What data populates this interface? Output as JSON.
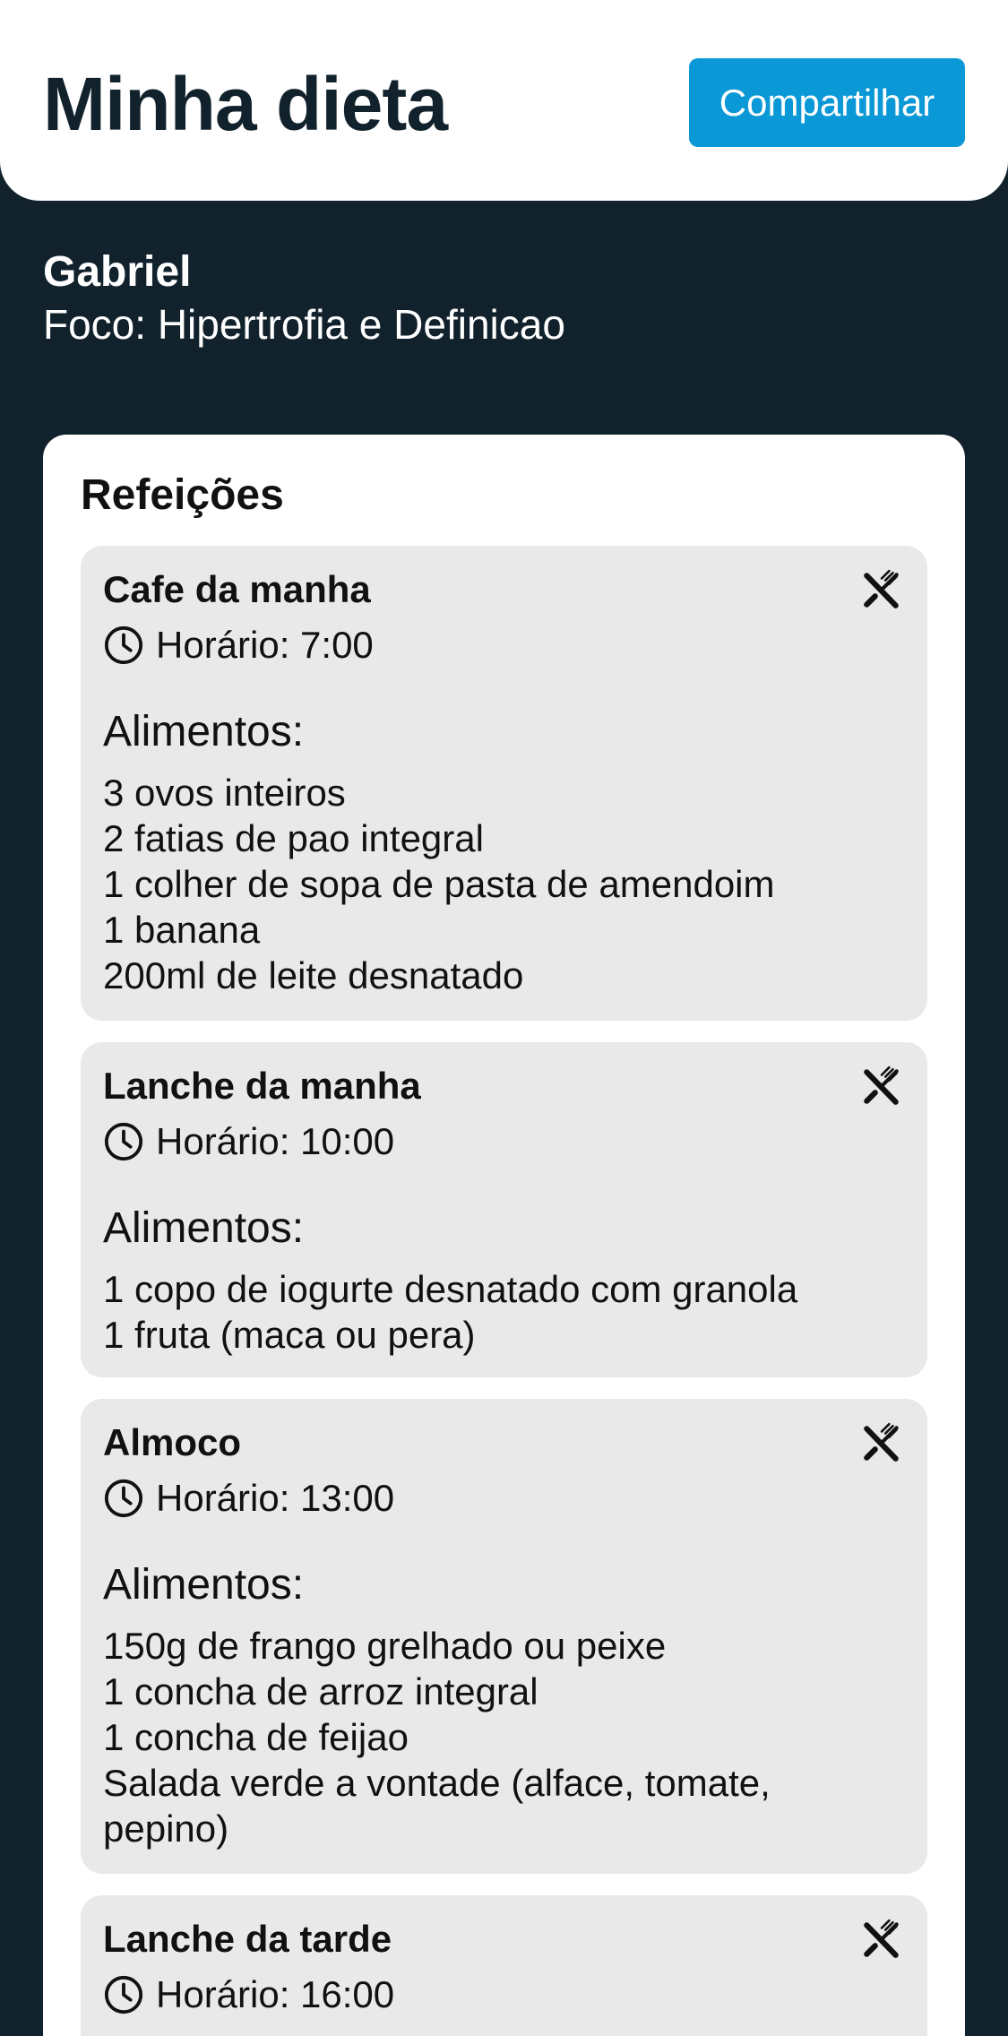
{
  "header": {
    "title": "Minha dieta",
    "share_label": "Compartilhar"
  },
  "user": {
    "name": "Gabriel",
    "focus": "Foco: Hipertrofia e Definicao"
  },
  "meals_section": {
    "title": "Refeições",
    "foods_label": "Alimentos:",
    "meals": [
      {
        "name": "Cafe da manha",
        "time": "Horário: 7:00",
        "foods": [
          "3 ovos inteiros",
          "2 fatias de pao integral",
          "1 colher de sopa de pasta de amendoim",
          "1 banana",
          "200ml de leite desnatado"
        ]
      },
      {
        "name": "Lanche da manha",
        "time": "Horário: 10:00",
        "foods": [
          "1 copo de iogurte desnatado com granola",
          "1 fruta (maca ou pera)"
        ]
      },
      {
        "name": "Almoco",
        "time": "Horário: 13:00",
        "foods": [
          "150g de frango grelhado ou peixe",
          "1 concha de arroz integral",
          "1 concha de feijao",
          "Salada verde a vontade (alface, tomate,",
          "pepino)"
        ]
      },
      {
        "name": "Lanche da tarde",
        "time": "Horário: 16:00",
        "foods": []
      }
    ]
  },
  "icons": {
    "meal": "utensils-icon",
    "time": "clock-icon"
  },
  "colors": {
    "background": "#12222d",
    "accent": "#0a98d6",
    "meal_card": "#e9e9e9"
  }
}
